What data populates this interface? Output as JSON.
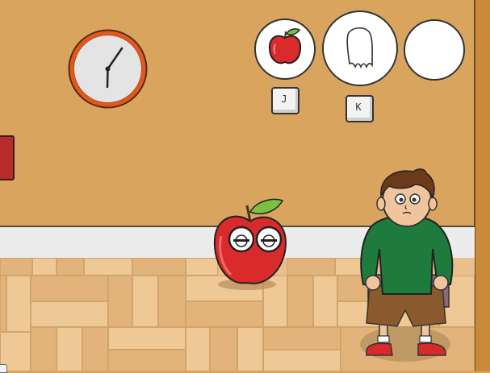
{
  "inventory": {
    "slots": [
      {
        "item": "apple-icon",
        "key_label": "J"
      },
      {
        "item": "ghost-icon",
        "key_label": "K"
      },
      {
        "item": "empty",
        "key_label": ""
      }
    ]
  },
  "clock": {
    "hour_hand_angle_deg": 180,
    "minute_hand_angle_deg": 35
  },
  "colors": {
    "wall": "#d9a55e",
    "floor": "#e9c08c",
    "apple_red": "#d92b2b",
    "leaf_green": "#7cc043",
    "shirt_green": "#1f7a3d",
    "clock_rim": "#e05a1e"
  },
  "characters": [
    "apple-character",
    "boy-character"
  ]
}
